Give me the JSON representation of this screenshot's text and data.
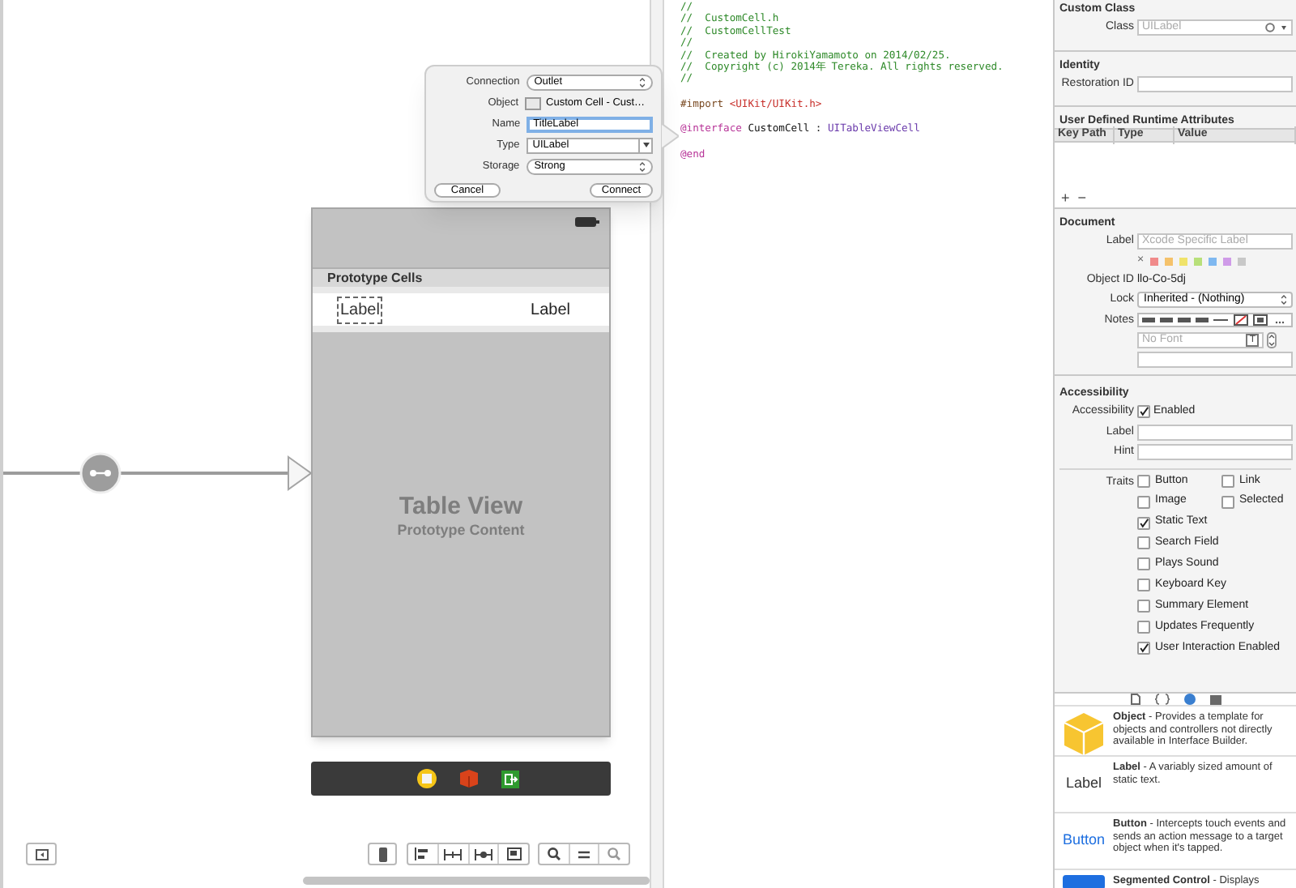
{
  "popover": {
    "rows": [
      {
        "label": "Connection",
        "kind": "popup",
        "value": "Outlet"
      },
      {
        "label": "Object",
        "kind": "object",
        "value": "Custom Cell - Cust…"
      },
      {
        "label": "Name",
        "kind": "field",
        "value": "TitleLabel"
      },
      {
        "label": "Type",
        "kind": "combo",
        "value": "UILabel"
      },
      {
        "label": "Storage",
        "kind": "popup",
        "value": "Strong"
      }
    ],
    "buttons": [
      "Cancel",
      "Connect"
    ]
  },
  "scene": {
    "section_header": "Prototype Cells",
    "cell_labels": [
      "Label",
      "Label"
    ],
    "title": "Table View",
    "subtitle": "Prototype Content"
  },
  "code": [
    {
      "kind": "comment",
      "segments": [
        {
          "kind": "comment",
          "text": "//"
        }
      ]
    },
    {
      "kind": "comment",
      "segments": [
        {
          "kind": "comment",
          "text": "//  CustomCell.h"
        }
      ]
    },
    {
      "kind": "comment",
      "segments": [
        {
          "kind": "comment",
          "text": "//  CustomCellTest"
        }
      ]
    },
    {
      "kind": "comment",
      "segments": [
        {
          "kind": "comment",
          "text": "//"
        }
      ]
    },
    {
      "kind": "comment",
      "segments": [
        {
          "kind": "comment",
          "text": "//  Created by HirokiYamamoto on 2014/02/25."
        }
      ]
    },
    {
      "kind": "comment",
      "segments": [
        {
          "kind": "comment",
          "text": "//  Copyright (c) 2014年 Tereka. All rights reserved."
        }
      ]
    },
    {
      "kind": "comment",
      "segments": [
        {
          "kind": "comment",
          "text": "//"
        }
      ]
    },
    {
      "kind": "import",
      "segments": [
        {
          "kind": "directive",
          "text": "#import "
        },
        {
          "kind": "string",
          "text": "<UIKit/UIKit.h>"
        }
      ]
    },
    {
      "kind": "interface",
      "segments": [
        {
          "kind": "keyword",
          "text": "@interface"
        },
        {
          "kind": "plain",
          "text": " CustomCell : "
        },
        {
          "kind": "class",
          "text": "UITableViewCell"
        }
      ]
    },
    {
      "kind": "end",
      "segments": [
        {
          "kind": "keyword",
          "text": "@end"
        }
      ]
    }
  ],
  "inspector": {
    "custom_class": {
      "title": "Custom Class",
      "class_label": "Class",
      "class_placeholder": "UILabel"
    },
    "identity": {
      "title": "Identity",
      "restoration_label": "Restoration ID"
    },
    "runtime_attributes": {
      "title": "User Defined Runtime Attributes",
      "columns": [
        "Key Path",
        "Type",
        "Value"
      ],
      "add": "+",
      "remove": "−"
    },
    "document": {
      "title": "Document",
      "label_label": "Label",
      "label_placeholder": "Xcode Specific Label",
      "clear": "×",
      "object_id_label": "Object ID",
      "object_id": "llo-Co-5dj",
      "lock_label": "Lock",
      "lock": "Inherited - (Nothing)",
      "notes_label": "Notes",
      "font_placeholder": "No Font",
      "font_button": "T"
    },
    "accessibility": {
      "title": "Accessibility",
      "accessibility_label": "Accessibility",
      "enabled": {
        "label": "Enabled",
        "checked": true
      },
      "label_label": "Label",
      "hint_label": "Hint",
      "traits_label": "Traits",
      "traits": [
        {
          "label": "Button",
          "checked": false
        },
        {
          "label": "Link",
          "checked": false
        },
        {
          "label": "Image",
          "checked": false
        },
        {
          "label": "Selected",
          "checked": false
        },
        {
          "label": "Static Text",
          "checked": true
        },
        {
          "label": "Search Field",
          "checked": false
        },
        {
          "label": "Plays Sound",
          "checked": false
        },
        {
          "label": "Keyboard Key",
          "checked": false
        },
        {
          "label": "Summary Element",
          "checked": false
        },
        {
          "label": "Updates Frequently",
          "checked": false
        },
        {
          "label": "User Interaction Enabled",
          "checked": true
        }
      ]
    }
  },
  "library": {
    "tabs": [
      {
        "kind": "file",
        "selected": false
      },
      {
        "kind": "braces",
        "selected": false
      },
      {
        "kind": "cube",
        "selected": true
      },
      {
        "kind": "media",
        "selected": false
      }
    ],
    "items": [
      {
        "kind": "object",
        "text": "**Object** - Provides a template for objects and controllers not directly available in Interface Builder."
      },
      {
        "kind": "label",
        "icon_text": "Label",
        "text": "**Label** - A variably sized amount of static text."
      },
      {
        "kind": "button",
        "icon_text": "Button",
        "text": "**Button** - Intercepts touch events and sends an action message to a target object when it's tapped."
      },
      {
        "kind": "segmented",
        "text": "**Segmented Control** - Displays"
      }
    ]
  }
}
